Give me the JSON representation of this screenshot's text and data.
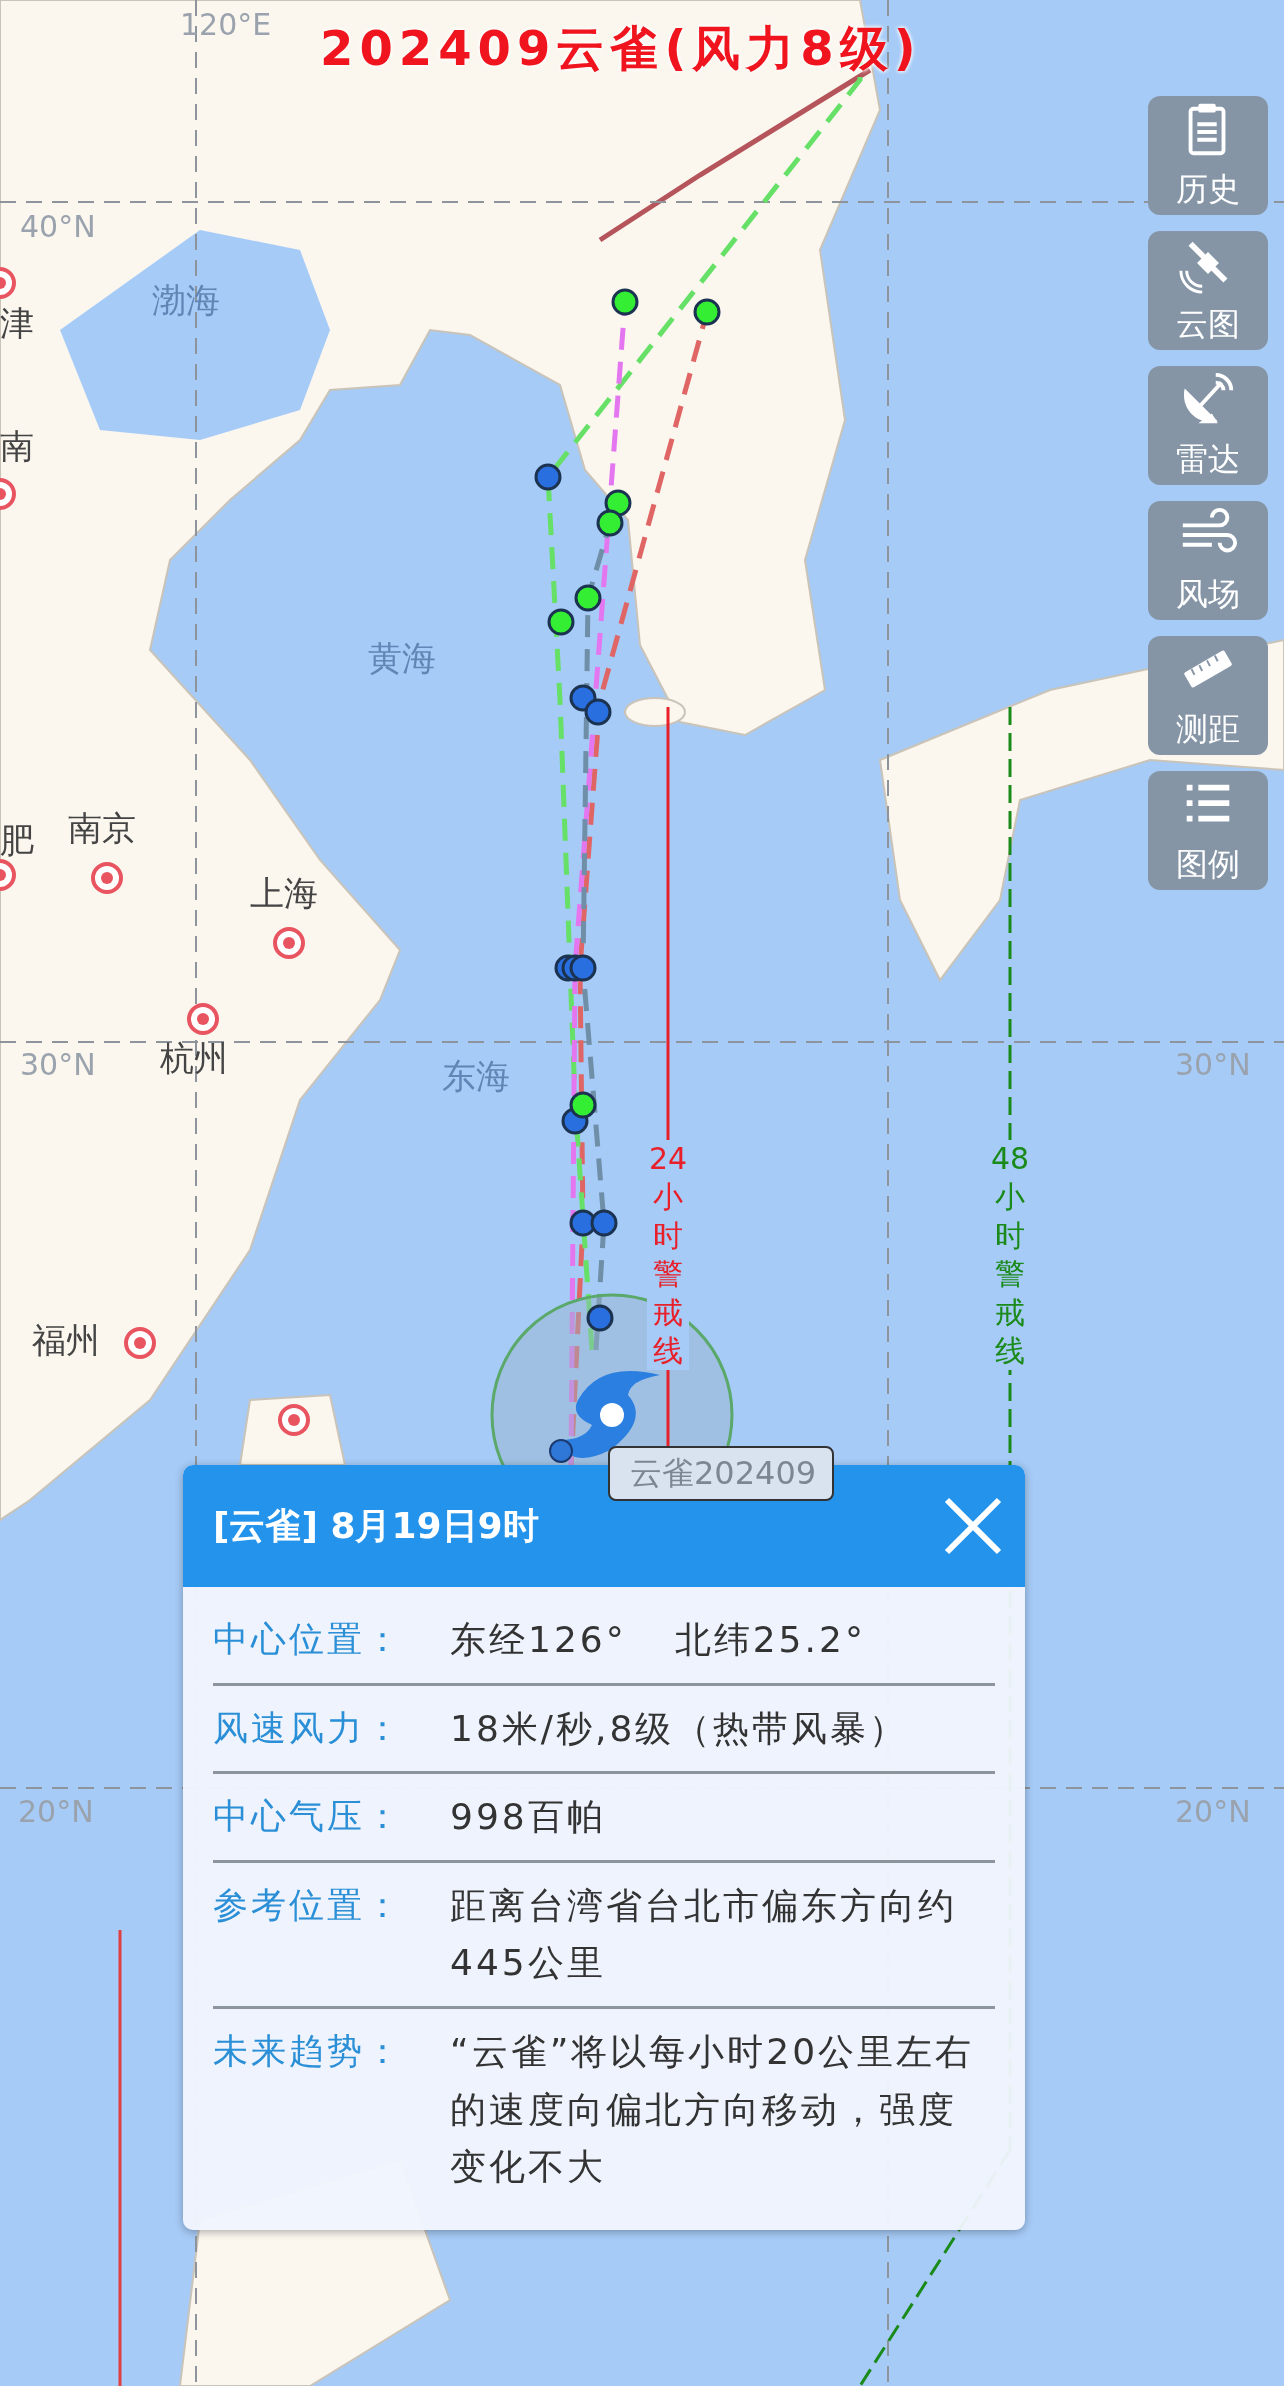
{
  "title": "202409云雀(风力8级)",
  "map": {
    "grid_labels": [
      "120°E",
      "40°N",
      "30°N",
      "30°N",
      "20°N",
      "20°N"
    ],
    "places": [
      {
        "name": "渤海",
        "kind": "sea"
      },
      {
        "name": "津",
        "kind": "city"
      },
      {
        "name": "南",
        "kind": "city"
      },
      {
        "name": "黄海",
        "kind": "sea"
      },
      {
        "name": "肥",
        "kind": "city"
      },
      {
        "name": "南京",
        "kind": "city"
      },
      {
        "name": "上海",
        "kind": "city"
      },
      {
        "name": "杭州",
        "kind": "city"
      },
      {
        "name": "东海",
        "kind": "sea"
      },
      {
        "name": "福州",
        "kind": "city"
      }
    ],
    "warning_lines": [
      {
        "label": "24小时警戒线",
        "color": "#e8202a",
        "kind": "solid"
      },
      {
        "label": "48小时警戒线",
        "color": "#1a8a1a",
        "kind": "dashed"
      }
    ],
    "storm_label": "云雀202409"
  },
  "toolbar": [
    {
      "label": "历史",
      "kind": "history"
    },
    {
      "label": "云图",
      "kind": "satellite"
    },
    {
      "label": "雷达",
      "kind": "radar"
    },
    {
      "label": "风场",
      "kind": "wind"
    },
    {
      "label": "测距",
      "kind": "ruler"
    },
    {
      "label": "图例",
      "kind": "legend"
    }
  ],
  "popup": {
    "title": "[云雀] 8月19日9时",
    "rows": [
      {
        "label": "中心位置：",
        "values": [
          "东经126°",
          "北纬25.2°"
        ]
      },
      {
        "label": "风速风力：",
        "values": [
          "18米/秒,8级（热带风暴）"
        ]
      },
      {
        "label": "中心气压：",
        "values": [
          "998百帕"
        ]
      },
      {
        "label": "参考位置：",
        "values": [
          "距离台湾省台北市偏东方向约445公里"
        ]
      },
      {
        "label": "未来趋势：",
        "values": [
          "“云雀”将以每小时20公里左右的速度向偏北方向移动，强度变化不大"
        ]
      }
    ]
  }
}
